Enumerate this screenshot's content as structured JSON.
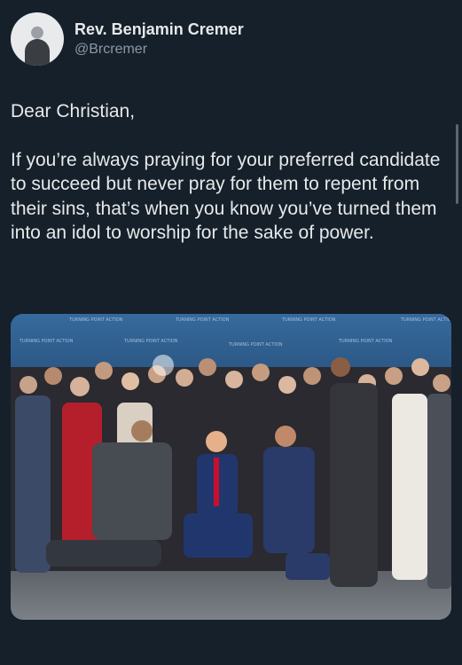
{
  "author": {
    "display_name": "Rev. Benjamin Cremer",
    "handle": "@Brcremer"
  },
  "tweet": {
    "greeting": "Dear Christian,",
    "body": "If you’re always praying for your preferred candidate to succeed but never pray for them to repent from their sins, that’s when you know you’ve turned them into an idol to worship for the sake of power."
  },
  "media": {
    "banner_text": "TURNING POINT ACTION",
    "colors": {
      "backdrop": "#2d5d8f",
      "floor": "#6e7177"
    }
  }
}
